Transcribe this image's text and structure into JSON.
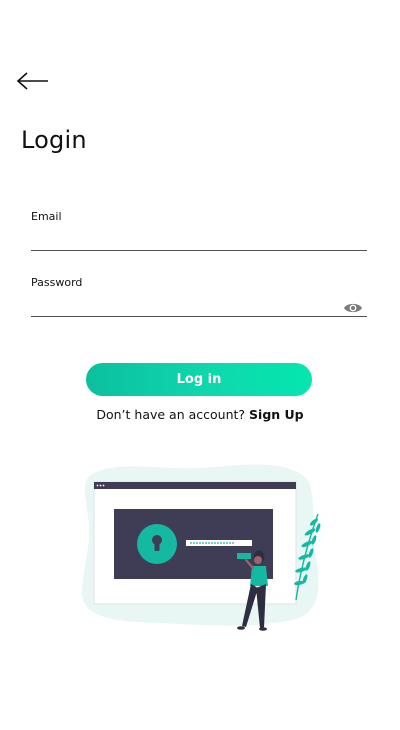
{
  "header": {
    "back_icon": "arrow-left-icon",
    "title": "Login"
  },
  "form": {
    "email": {
      "label": "Email",
      "value": "",
      "placeholder": ""
    },
    "password": {
      "label": "Password",
      "value": "",
      "placeholder": "",
      "toggle_icon": "eye-icon"
    },
    "login_label": "Log in"
  },
  "signup": {
    "prompt": "Don’t have an account?",
    "link_label": "Sign Up"
  },
  "illustration": {
    "icon": "login-illustration"
  },
  "colors": {
    "accent_start": "#0bbf9e",
    "accent_end": "#05e6b0",
    "illustration_panel": "#3f3d56",
    "illustration_teal": "#15b8a0",
    "blob": "#e8f7f4"
  }
}
